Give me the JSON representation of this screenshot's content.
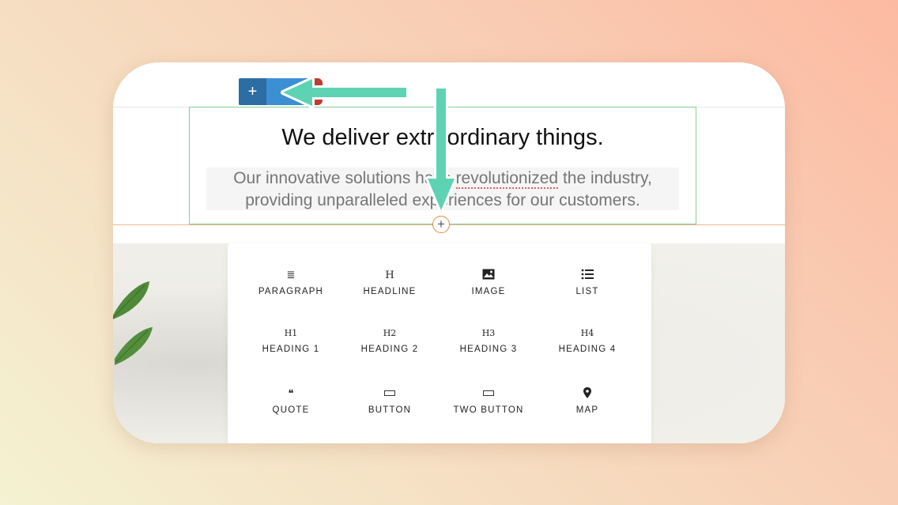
{
  "toolbar": {
    "add_symbol": "+"
  },
  "section": {
    "headline": "We deliver extraordinary things.",
    "subtext_line1_a": "Our innovative solutions have ",
    "subtext_line1_b": "revolutionized",
    "subtext_line1_c": " the industry,",
    "subtext_line2": "providing unparalleled experiences for our customers."
  },
  "insert": {
    "symbol": "+"
  },
  "blocks": [
    {
      "label": "PARAGRAPH",
      "icon": "paragraph-icon",
      "glyph": "≣"
    },
    {
      "label": "HEADLINE",
      "icon": "headline-icon",
      "glyph": "H"
    },
    {
      "label": "IMAGE",
      "icon": "image-icon",
      "glyph": ""
    },
    {
      "label": "LIST",
      "icon": "list-icon",
      "glyph": ""
    },
    {
      "label": "HEADING 1",
      "icon": "heading1-icon",
      "glyph": "H1"
    },
    {
      "label": "HEADING 2",
      "icon": "heading2-icon",
      "glyph": "H2"
    },
    {
      "label": "HEADING 3",
      "icon": "heading3-icon",
      "glyph": "H3"
    },
    {
      "label": "HEADING 4",
      "icon": "heading4-icon",
      "glyph": "H4"
    },
    {
      "label": "QUOTE",
      "icon": "quote-icon",
      "glyph": "❝"
    },
    {
      "label": "BUTTON",
      "icon": "button-icon",
      "glyph": ""
    },
    {
      "label": "TWO BUTTON",
      "icon": "two-button-icon",
      "glyph": ""
    },
    {
      "label": "MAP",
      "icon": "map-pin-icon",
      "glyph": ""
    }
  ],
  "colors": {
    "accent_arrow": "#5ed3b4",
    "add_button": "#2c6ea3",
    "selection_border": "#88cc96"
  }
}
